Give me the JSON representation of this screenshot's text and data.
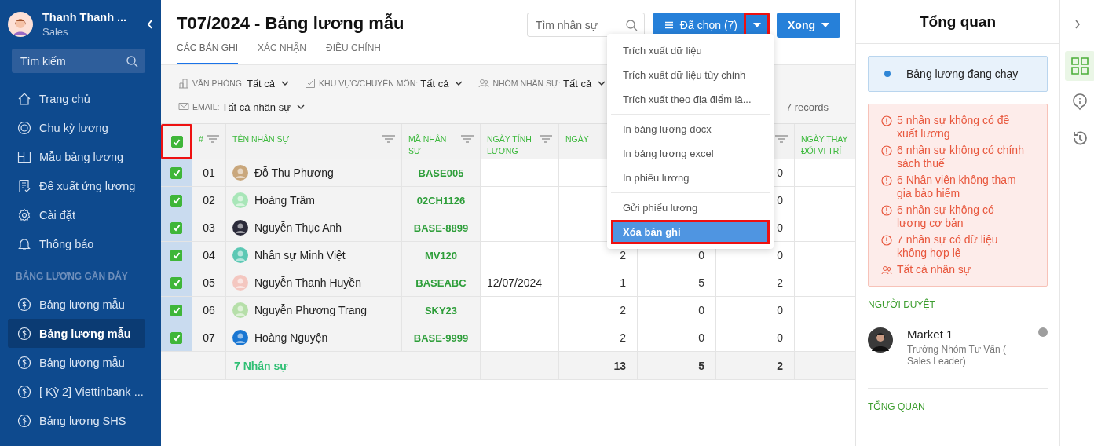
{
  "sidebar": {
    "user": {
      "name": "Thanh Thanh ...",
      "role": "Sales"
    },
    "search": {
      "placeholder": "Tìm kiếm"
    },
    "nav": [
      {
        "label": "Trang chủ",
        "kind": "home"
      },
      {
        "label": "Chu kỳ lương",
        "kind": "cycle"
      },
      {
        "label": "Mẫu bảng lương",
        "kind": "template"
      },
      {
        "label": "Đề xuất ứng lương",
        "kind": "proposal"
      },
      {
        "label": "Cài đặt",
        "kind": "settings"
      },
      {
        "label": "Thông báo",
        "kind": "bell"
      }
    ],
    "recent_heading": "BẢNG LƯƠNG GẦN ĐÂY",
    "recent": [
      {
        "label": "Bảng lương mẫu",
        "selected": false
      },
      {
        "label": "Bảng lương mẫu",
        "selected": true
      },
      {
        "label": "Bảng lương mẫu",
        "selected": false
      },
      {
        "label": "[ Kỳ 2] Viettinbank ...",
        "selected": false
      },
      {
        "label": "Bảng lương SHS",
        "selected": false
      }
    ]
  },
  "header": {
    "title": "T07/2024 - Bảng lương mẫu",
    "search": {
      "placeholder": "Tìm nhân sự"
    },
    "selected_button": {
      "label": "Đã chọn (7)",
      "toggle_highlighted": true
    },
    "done_button": {
      "label": "Xong"
    }
  },
  "tabs": [
    {
      "label": "CÁC BẢN GHI",
      "selected": true
    },
    {
      "label": "XÁC NHẬN",
      "selected": false
    },
    {
      "label": "ĐIỀU CHỈNH",
      "selected": false
    }
  ],
  "filters": [
    {
      "label": "VĂN PHÒNG:",
      "value": "Tất cả",
      "kind": "office"
    },
    {
      "label": "KHU VỰC/CHUYÊN MÔN:",
      "value": "Tất cả",
      "kind": "check"
    },
    {
      "label": "NHÓM NHÂN SỰ:",
      "value": "Tất cả",
      "kind": "people"
    },
    {
      "label": "EMAIL:",
      "value": "Tất cả nhân sự",
      "kind": "mail"
    }
  ],
  "record_count": "7 records",
  "table": {
    "select_all": {
      "checked": true,
      "highlighted": true
    },
    "columns": [
      {
        "label": "#",
        "filter": true
      },
      {
        "label": "TÊN NHÂN SỰ",
        "filter": true
      },
      {
        "label": "MÃ NHÂN SỰ",
        "filter": true
      },
      {
        "label": "NGÀY TÍNH LƯƠNG",
        "filter": true
      },
      {
        "label": "NGÀY"
      },
      {
        "filter": true
      },
      {
        "label": "NGÀY THAY ĐỔI VỊ TRÍ"
      }
    ],
    "rows": [
      {
        "checked": true,
        "no": "01",
        "name": "Đỗ Thu Phương",
        "color": "#c9a77c",
        "code": "BASE005",
        "col_7": "0"
      },
      {
        "checked": true,
        "no": "02",
        "name": "Hoàng Trâm",
        "color": "#a8e6b8",
        "code": "02CH1126",
        "col_7": "0"
      },
      {
        "checked": true,
        "no": "03",
        "name": "Nguyễn Thục Anh",
        "color": "#2b2b3a",
        "code": "BASE-8899",
        "col_7": "0"
      },
      {
        "checked": true,
        "no": "04",
        "name": "Nhân sự Minh Việt",
        "color": "#5cc8b4",
        "code": "MV120",
        "col_5": "2",
        "col_6": "0",
        "col_7": "0"
      },
      {
        "checked": true,
        "no": "05",
        "name": "Nguyễn Thanh Huyền",
        "date": "12/07/2024",
        "color": "#f4c7c0",
        "code": "BASEABC",
        "col_5": "1",
        "col_6": "5",
        "col_7": "2"
      },
      {
        "checked": true,
        "no": "06",
        "name": "Nguyễn Phương Trang",
        "color": "#b6dfa9",
        "code": "SKY23",
        "col_5": "2",
        "col_6": "0",
        "col_7": "0"
      },
      {
        "checked": true,
        "no": "07",
        "name": "Hoàng Nguyện",
        "color": "#1976d2",
        "code": "BASE-9999",
        "col_5": "2",
        "col_6": "0",
        "col_7": "0"
      }
    ],
    "footer": {
      "label": "7 Nhân sự",
      "values": [
        "13",
        "5",
        "2"
      ]
    }
  },
  "menu": {
    "groups": [
      [
        {
          "label": "Trích xuất dữ liệu",
          "selected": false,
          "highlighted": false
        },
        {
          "label": "Trích xuất dữ liệu tùy chỉnh",
          "selected": false,
          "highlighted": false
        },
        {
          "label": "Trích xuất theo địa điểm là...",
          "selected": false,
          "highlighted": false
        }
      ],
      [
        {
          "label": "In bảng lương docx",
          "selected": false,
          "highlighted": false
        },
        {
          "label": "In bảng lương excel",
          "selected": false,
          "highlighted": false
        },
        {
          "label": "In phiếu lương",
          "selected": false,
          "highlighted": false
        }
      ],
      [
        {
          "label": "Gửi phiếu lương",
          "selected": false,
          "highlighted": false
        },
        {
          "label": "Xóa bản ghi",
          "selected": true,
          "highlighted": true
        }
      ]
    ]
  },
  "overview": {
    "title": "Tổng quan",
    "status": "Bảng lương đang chạy",
    "warnings": [
      {
        "text": "5 nhân sự không có đề xuất lương",
        "kind": "warning"
      },
      {
        "text": "6 nhân sự không có chính sách thuế",
        "kind": "warning"
      },
      {
        "text": "6 Nhân viên không tham gia bảo hiểm",
        "kind": "warning"
      },
      {
        "text": "6 nhân sự không có lương cơ bản",
        "kind": "warning"
      },
      {
        "text": "7 nhân sự có dữ liệu không hợp lệ",
        "kind": "warning"
      },
      {
        "text": "Tất cả nhân sự",
        "kind": "people"
      }
    ],
    "approver_heading": "NGƯỜI DUYỆT",
    "approver": {
      "name": "Market 1",
      "role": "Trưởng Nhóm Tư Vấn ( Sales Leader)"
    },
    "summary_heading": "TỔNG QUAN"
  },
  "rail": [
    {
      "kind": "grid",
      "selected": true
    },
    {
      "kind": "info",
      "selected": false
    },
    {
      "kind": "history",
      "selected": false
    }
  ]
}
